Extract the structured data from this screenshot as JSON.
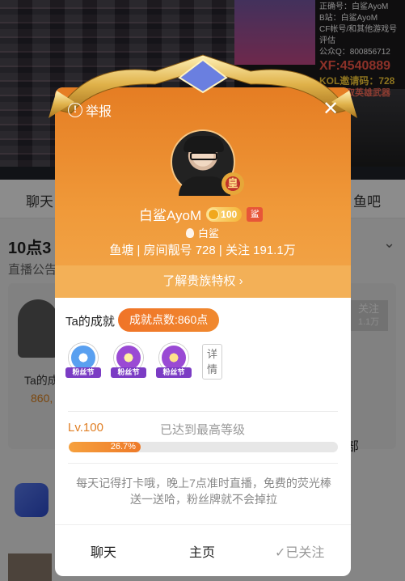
{
  "stream_overlay": {
    "lines": [
      "正确号：白鲨AyoM",
      "B站：白鲨AyoM",
      "CF帐号/和其他游戏号评估",
      "公众Q：800856712"
    ],
    "xf": "XF:4540889",
    "kol": "KOL邀请码：728",
    "reward": "免费领取英雄武器"
  },
  "bg": {
    "tabs": [
      "聊天",
      "鱼吧"
    ],
    "title": "10点3",
    "subtitle": "直播公告",
    "follow_label": "关注",
    "follow_count": "1.1万",
    "ta_text": "Ta的成",
    "ta_num": "860,",
    "dao": "部"
  },
  "modal": {
    "report_label": "举报",
    "name": "白鲨AyoM",
    "level": "100",
    "shark_badge": "鲨",
    "king_badge": "皇",
    "fans_label": "白鲨",
    "stats": "鱼塘 | 房间靓号  728 | 关注  191.1万",
    "privilege_link": "了解贵族特权 ›",
    "achievement_label": "Ta的成就",
    "achievement_points": "成就点数:860点",
    "medals": [
      {
        "ribbon": "粉丝节",
        "color": "#5aa0f0"
      },
      {
        "ribbon": "粉丝节",
        "color": "#f0a040"
      },
      {
        "ribbon": "粉丝节",
        "color": "#c9a0f0"
      }
    ],
    "detail_label": "详情",
    "level_label": "Lv.100",
    "level_status": "已达到最高等级",
    "progress_text": "26.7%",
    "progress_fraction": 0.267,
    "tip": "每天记得打卡哦，晚上7点准时直播，免费的荧光棒送一送哈，粉丝牌就不会掉拉",
    "footer": {
      "chat": "聊天",
      "home": "主页",
      "followed": "✓已关注"
    }
  }
}
